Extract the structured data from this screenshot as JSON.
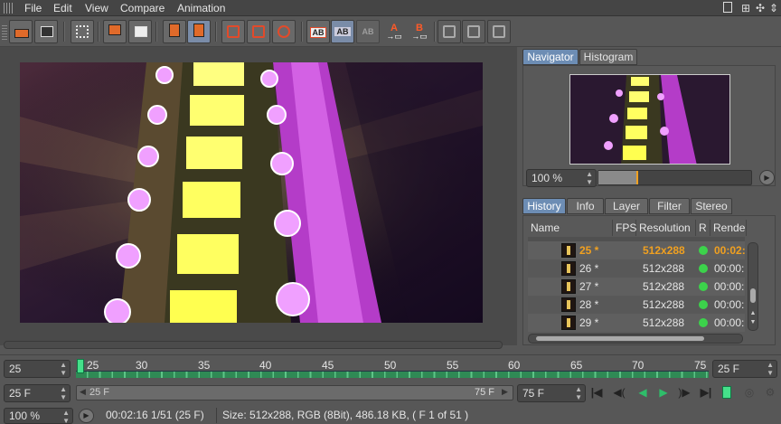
{
  "menu": {
    "file": "File",
    "edit": "Edit",
    "view": "View",
    "compare": "Compare",
    "animation": "Animation"
  },
  "toolbar": {
    "ab": "AB",
    "a_label": "A",
    "b_label": "B"
  },
  "navigator": {
    "tab_navigator": "Navigator",
    "tab_histogram": "Histogram",
    "zoom": "100 %"
  },
  "history": {
    "tabs": [
      "History",
      "Info",
      "Layer",
      "Filter",
      "Stereo"
    ],
    "columns": {
      "name": "Name",
      "fps": "FPS",
      "resolution": "Resolution",
      "r": "R",
      "render": "Render"
    },
    "rows": [
      {
        "name": "25 *",
        "resolution": "512x288",
        "time": "00:02:",
        "active": true
      },
      {
        "name": "26 *",
        "resolution": "512x288",
        "time": "00:00:",
        "active": false
      },
      {
        "name": "27 *",
        "resolution": "512x288",
        "time": "00:00:",
        "active": false
      },
      {
        "name": "28 *",
        "resolution": "512x288",
        "time": "00:00:",
        "active": false
      },
      {
        "name": "29 *",
        "resolution": "512x288",
        "time": "00:00:",
        "active": false
      }
    ]
  },
  "timeline": {
    "current_frame": "25",
    "ticks": [
      "25",
      "30",
      "35",
      "40",
      "45",
      "50",
      "55",
      "60",
      "65",
      "70",
      "75"
    ],
    "end_frame_field": "25 F",
    "range_start_field": "25 F",
    "range_start_label": "25 F",
    "range_end_label": "75 F",
    "range_end_field": "75 F"
  },
  "status": {
    "zoom": "100 %",
    "time": "00:02:16 1/51 (25 F)",
    "info": "Size: 512x288, RGB (8Bit), 486.18 KB,  ( F 1 of 51 )"
  },
  "colors": {
    "accent": "#6d8db4",
    "active_row": "#f0a020",
    "timeline_green": "#3caa6a",
    "dot_green": "#3cd24b"
  }
}
